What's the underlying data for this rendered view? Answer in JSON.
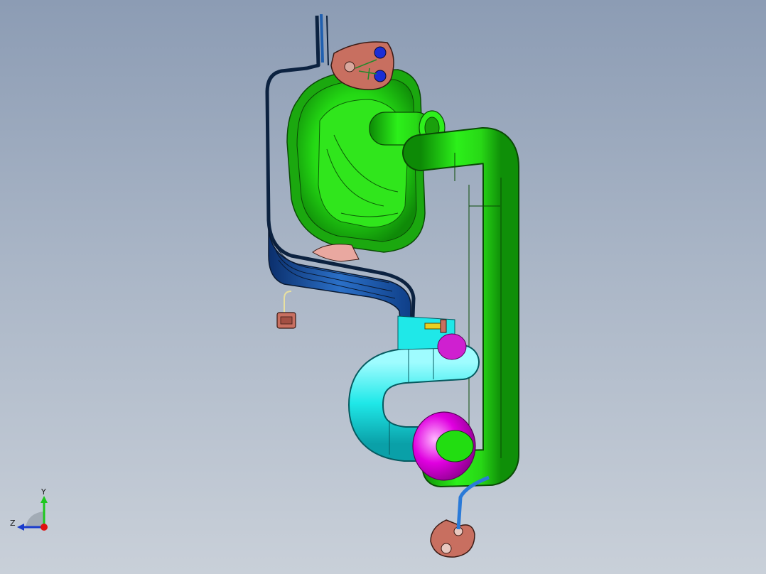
{
  "viewport": {
    "background_top": "#8c9cb4",
    "background_bottom": "#c9d0d9"
  },
  "model": {
    "parts": [
      {
        "name": "muffler-housing",
        "color": "#22dd11"
      },
      {
        "name": "tailpipe",
        "color": "#22dd11"
      },
      {
        "name": "heat-shield-bracket",
        "color": "#1f5fb0"
      },
      {
        "name": "intake-pipe",
        "color": "#1fe8e8"
      },
      {
        "name": "flange-coupling",
        "color": "#e000e0"
      },
      {
        "name": "mounting-flange-top",
        "color": "#c86f60"
      },
      {
        "name": "mounting-flange-bottom",
        "color": "#c86f60"
      },
      {
        "name": "sensor-connector",
        "color": "#c86f60"
      },
      {
        "name": "oxygen-sensor",
        "color": "#e8d020"
      }
    ]
  },
  "triad": {
    "y_label": "Y",
    "z_label": "Z",
    "y_color": "#1ec81e",
    "z_color": "#1a3ccc",
    "x_color": "#e01010"
  }
}
